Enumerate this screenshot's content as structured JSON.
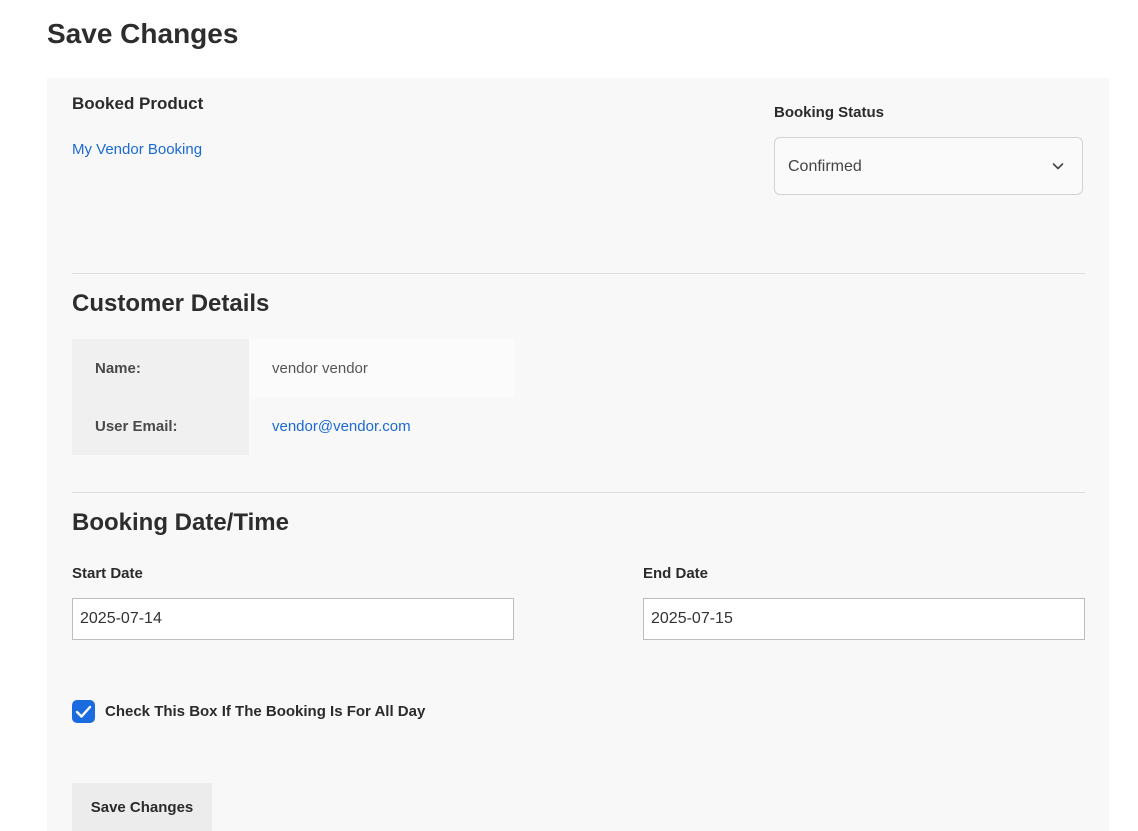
{
  "page_title": "Save Changes",
  "booked_product": {
    "label": "Booked Product",
    "link_text": "My Vendor Booking"
  },
  "booking_status": {
    "label": "Booking Status",
    "selected": "Confirmed",
    "icon": "chevron-down-icon"
  },
  "customer_details": {
    "heading": "Customer Details",
    "rows": [
      {
        "label": "Name:",
        "value": "vendor vendor"
      },
      {
        "label": "User Email:",
        "value": "vendor@vendor.com"
      }
    ]
  },
  "booking_datetime": {
    "heading": "Booking Date/Time",
    "start_label": "Start Date",
    "start_value": "2025-07-14",
    "end_label": "End Date",
    "end_value": "2025-07-15"
  },
  "all_day": {
    "label": "Check This Box If The Booking Is For All Day",
    "checked": true,
    "icon": "checkmark-icon"
  },
  "save_button": "Save Changes",
  "colors": {
    "accent": "#1a6be0",
    "link": "#1b6ad3",
    "panel_bg": "#f8f8f8"
  }
}
